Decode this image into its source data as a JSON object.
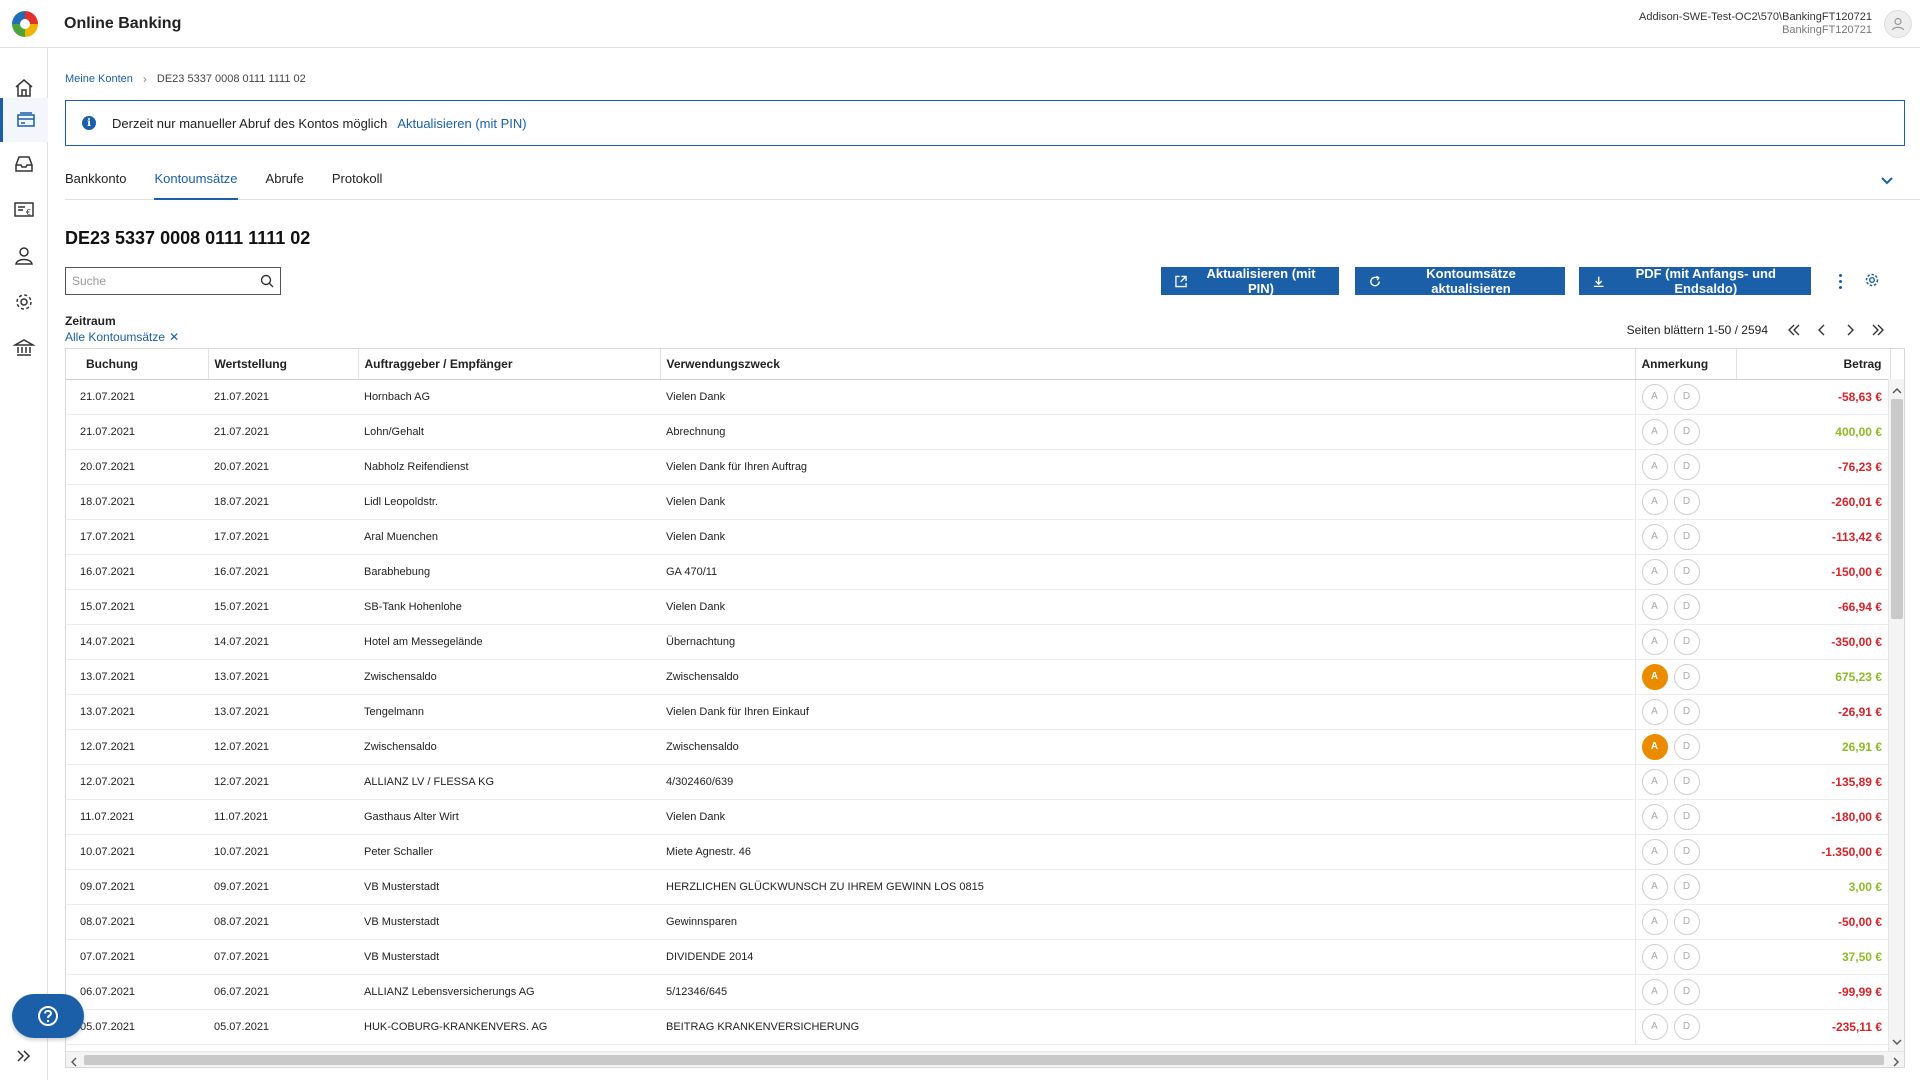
{
  "header": {
    "app_title": "Online Banking",
    "user_line1": "Addison-SWE-Test-OC2\\570\\BankingFT120721",
    "user_line2": "BankingFT120721"
  },
  "rail": {
    "icons": [
      "home-icon",
      "accounts-icon",
      "inbox-icon",
      "payments-icon",
      "contacts-icon",
      "settings-icon",
      "bank-icon"
    ],
    "active": "accounts-icon"
  },
  "breadcrumb": {
    "parent": "Meine Konten",
    "current": "DE23 5337 0008 0111 1111 02"
  },
  "info": {
    "text": "Derzeit nur manueller Abruf des Kontos möglich",
    "link": "Aktualisieren (mit PIN)"
  },
  "tabs": [
    "Bankkonto",
    "Kontoumsätze",
    "Abrufe",
    "Protokoll"
  ],
  "active_tab": "Kontoumsätze",
  "account_title": "DE23 5337 0008 0111 1111 02",
  "search": {
    "placeholder": "Suche"
  },
  "buttons": {
    "refresh_pin": "Aktualisieren (mit PIN)",
    "refresh_tx": "Kontoumsätze aktualisieren",
    "pdf": "PDF (mit Anfangs- und Endsaldo)"
  },
  "filter": {
    "label": "Zeitraum",
    "value": "Alle Kontoumsätze"
  },
  "pager": {
    "label": "Seiten blättern 1-50 / 2594"
  },
  "table": {
    "columns": {
      "buchung": "Buchung",
      "wertstellung": "Wertstellung",
      "partner": "Auftraggeber / Empfänger",
      "zweck": "Verwendungszweck",
      "anmerkung": "Anmerkung",
      "betrag": "Betrag"
    },
    "note_labels": {
      "a": "A",
      "d": "D"
    },
    "rows": [
      {
        "buchung": "21.07.2021",
        "wert": "21.07.2021",
        "partner": "Hornbach AG",
        "zweck": "Vielen Dank",
        "a_active": false,
        "betrag": "-58,63 €",
        "neg": true
      },
      {
        "buchung": "21.07.2021",
        "wert": "21.07.2021",
        "partner": "Lohn/Gehalt",
        "zweck": "Abrechnung",
        "a_active": false,
        "betrag": "400,00 €",
        "neg": false
      },
      {
        "buchung": "20.07.2021",
        "wert": "20.07.2021",
        "partner": "Nabholz Reifendienst",
        "zweck": "Vielen Dank für Ihren Auftrag",
        "a_active": false,
        "betrag": "-76,23 €",
        "neg": true
      },
      {
        "buchung": "18.07.2021",
        "wert": "18.07.2021",
        "partner": "Lidl Leopoldstr.",
        "zweck": "Vielen Dank",
        "a_active": false,
        "betrag": "-260,01 €",
        "neg": true
      },
      {
        "buchung": "17.07.2021",
        "wert": "17.07.2021",
        "partner": "Aral Muenchen",
        "zweck": "Vielen Dank",
        "a_active": false,
        "betrag": "-113,42 €",
        "neg": true
      },
      {
        "buchung": "16.07.2021",
        "wert": "16.07.2021",
        "partner": "Barabhebung",
        "zweck": "GA 470/11",
        "a_active": false,
        "betrag": "-150,00 €",
        "neg": true
      },
      {
        "buchung": "15.07.2021",
        "wert": "15.07.2021",
        "partner": "SB-Tank Hohenlohe",
        "zweck": "Vielen Dank",
        "a_active": false,
        "betrag": "-66,94 €",
        "neg": true
      },
      {
        "buchung": "14.07.2021",
        "wert": "14.07.2021",
        "partner": "Hotel am Messegelände",
        "zweck": "Übernachtung",
        "a_active": false,
        "betrag": "-350,00 €",
        "neg": true
      },
      {
        "buchung": "13.07.2021",
        "wert": "13.07.2021",
        "partner": "Zwischensaldo",
        "zweck": "Zwischensaldo",
        "a_active": true,
        "betrag": "675,23 €",
        "neg": false
      },
      {
        "buchung": "13.07.2021",
        "wert": "13.07.2021",
        "partner": "Tengelmann",
        "zweck": "Vielen Dank für Ihren Einkauf",
        "a_active": false,
        "betrag": "-26,91 €",
        "neg": true
      },
      {
        "buchung": "12.07.2021",
        "wert": "12.07.2021",
        "partner": "Zwischensaldo",
        "zweck": "Zwischensaldo",
        "a_active": true,
        "betrag": "26,91 €",
        "neg": false
      },
      {
        "buchung": "12.07.2021",
        "wert": "12.07.2021",
        "partner": "ALLIANZ LV / FLESSA KG",
        "zweck": "4/302460/639",
        "a_active": false,
        "betrag": "-135,89 €",
        "neg": true
      },
      {
        "buchung": "11.07.2021",
        "wert": "11.07.2021",
        "partner": "Gasthaus Alter Wirt",
        "zweck": "Vielen Dank",
        "a_active": false,
        "betrag": "-180,00 €",
        "neg": true
      },
      {
        "buchung": "10.07.2021",
        "wert": "10.07.2021",
        "partner": "Peter Schaller",
        "zweck": "Miete Agnestr. 46",
        "a_active": false,
        "betrag": "-1.350,00 €",
        "neg": true
      },
      {
        "buchung": "09.07.2021",
        "wert": "09.07.2021",
        "partner": "VB Musterstadt",
        "zweck": "HERZLICHEN GLÜCKWUNSCH ZU IHREM GEWINN LOS 0815",
        "a_active": false,
        "betrag": "3,00 €",
        "neg": false
      },
      {
        "buchung": "08.07.2021",
        "wert": "08.07.2021",
        "partner": "VB Musterstadt",
        "zweck": "Gewinnsparen",
        "a_active": false,
        "betrag": "-50,00 €",
        "neg": true
      },
      {
        "buchung": "07.07.2021",
        "wert": "07.07.2021",
        "partner": "VB Musterstadt",
        "zweck": "DIVIDENDE 2014",
        "a_active": false,
        "betrag": "37,50 €",
        "neg": false
      },
      {
        "buchung": "06.07.2021",
        "wert": "06.07.2021",
        "partner": "ALLIANZ Lebensversicherungs AG",
        "zweck": "5/12346/645",
        "a_active": false,
        "betrag": "-99,99 €",
        "neg": true
      },
      {
        "buchung": "05.07.2021",
        "wert": "05.07.2021",
        "partner": "HUK-COBURG-KRANKENVERS. AG",
        "zweck": "BEITRAG KRANKENVERSICHERUNG",
        "a_active": false,
        "betrag": "-235,11 €",
        "neg": true
      }
    ]
  },
  "colors": {
    "accent": "#1a5fa8",
    "negative": "#d8232a",
    "positive": "#8dbb25",
    "note_active": "#eb8c00"
  }
}
